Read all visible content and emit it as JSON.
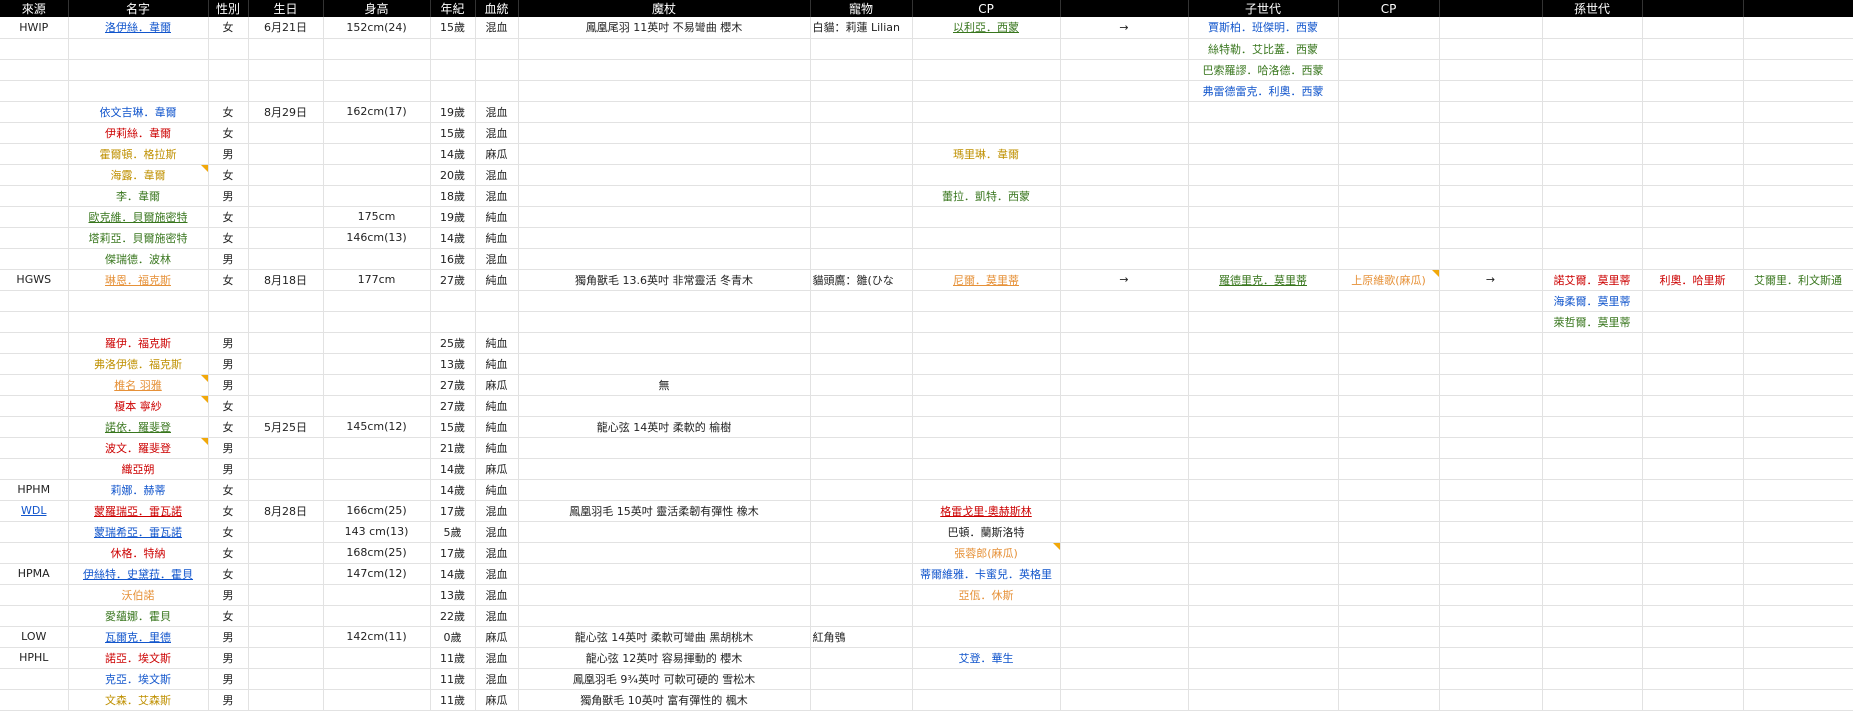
{
  "headers": [
    "來源",
    "名字",
    "性別",
    "生日",
    "身高",
    "年紀",
    "血統",
    "魔杖",
    "寵物",
    "CP",
    "",
    "子世代",
    "CP",
    "",
    "孫世代",
    "",
    ""
  ],
  "colors": {
    "blue": "#1155cc",
    "red": "#cc0000",
    "orange": "#e69138",
    "green": "#38761d",
    "gold": "#bf9000",
    "comment_marker": "#f1a80a"
  },
  "rows": [
    {
      "src": "HWIP",
      "name": "洛伊絲．韋爾",
      "nc": "blue u",
      "sex": "女",
      "bday": "6月21日",
      "height": "152cm(24)",
      "age": "15歲",
      "blood": "混血",
      "wand": "鳳凰尾羽 11英吋 不易彎曲 櫻木",
      "pet": "白貓：莉蓮 Lilian",
      "cp": "以利亞．西蒙",
      "cpc": "green u",
      "arrow": "→",
      "child": "賈斯柏．班傑明．西蒙",
      "chc": "blue"
    },
    {
      "child": "絲特勒．艾比蓋．西蒙",
      "chc": "green"
    },
    {
      "child": "巴索羅謬．哈洛德．西蒙",
      "chc": "green"
    },
    {
      "child": "弗雷德雷克．利奧．西蒙",
      "chc": "blue"
    },
    {
      "name": "依文吉琳．韋爾",
      "nc": "blue",
      "sex": "女",
      "bday": "8月29日",
      "height": "162cm(17)",
      "age": "19歲",
      "blood": "混血"
    },
    {
      "name": "伊莉絲．韋爾",
      "nc": "red",
      "sex": "女",
      "age": "15歲",
      "blood": "混血"
    },
    {
      "name": "霍爾頓．格拉斯",
      "nc": "gold",
      "sex": "男",
      "age": "14歲",
      "blood": "麻瓜",
      "cp": "瑪里琳．韋爾",
      "cpc": "gold"
    },
    {
      "name": "海露．韋爾",
      "nc": "gold",
      "note": true,
      "sex": "女",
      "age": "20歲",
      "blood": "混血"
    },
    {
      "name": "李．韋爾",
      "nc": "green",
      "sex": "男",
      "age": "18歲",
      "blood": "混血",
      "cp": "蕾拉．凱特．西蒙",
      "cpc": "green"
    },
    {
      "name": "歐克維．貝爾施密特",
      "nc": "green u",
      "sex": "女",
      "height": "175cm",
      "age": "19歲",
      "blood": "純血"
    },
    {
      "name": "塔莉亞．貝爾施密特",
      "nc": "green",
      "sex": "女",
      "height": "146cm(13)",
      "age": "14歲",
      "blood": "純血"
    },
    {
      "name": "傑瑞德．波林",
      "nc": "green",
      "sex": "男",
      "age": "16歲",
      "blood": "混血"
    },
    {
      "src": "HGWS",
      "name": "琳恩．福克斯",
      "nc": "orange u",
      "sex": "女",
      "bday": "8月18日",
      "height": "177cm",
      "age": "27歲",
      "blood": "純血",
      "wand": "獨角獸毛 13.6英吋 非常靈活 冬青木",
      "pet": "貓頭鷹：雛(ひな",
      "cp": "尼爾．莫里蒂",
      "cpc": "orange u",
      "arrow": "→",
      "child": "羅德里克．莫里蒂",
      "chc": "green u",
      "cp2": "上原維歌(麻瓜)",
      "cp2c": "orange",
      "cp2note": true,
      "arrow2": "→",
      "grand": "諾艾爾．莫里蒂",
      "gc": "red",
      "g2": "利奧．哈里斯",
      "g2c": "red",
      "g3": "艾爾里．利文斯通",
      "g3c": "green"
    },
    {
      "grand": "海柔爾．莫里蒂",
      "gc": "blue"
    },
    {
      "grand": "萊哲爾．莫里蒂",
      "gc": "green"
    },
    {
      "name": "羅伊．福克斯",
      "nc": "red",
      "sex": "男",
      "age": "25歲",
      "blood": "純血"
    },
    {
      "name": "弗洛伊德．福克斯",
      "nc": "gold",
      "sex": "男",
      "age": "13歲",
      "blood": "純血"
    },
    {
      "name": "椎名 羽雅",
      "nc": "orange u",
      "note": true,
      "sex": "男",
      "age": "27歲",
      "blood": "麻瓜",
      "wand": "無"
    },
    {
      "name": "榎本 寧紗",
      "nc": "red",
      "note": true,
      "sex": "女",
      "age": "27歲",
      "blood": "純血"
    },
    {
      "name": "諾依．羅斐登",
      "nc": "green u",
      "sex": "女",
      "bday": "5月25日",
      "height": "145cm(12)",
      "age": "15歲",
      "blood": "純血",
      "wand": "龍心弦 14英吋 柔軟的 榆樹"
    },
    {
      "name": "波文．羅斐登",
      "nc": "red",
      "note": true,
      "sex": "男",
      "age": "21歲",
      "blood": "純血"
    },
    {
      "name": "織亞朔",
      "nc": "red",
      "sex": "男",
      "age": "14歲",
      "blood": "麻瓜"
    },
    {
      "src": "HPHM",
      "name": "莉娜．赫蒂",
      "nc": "blue",
      "sex": "女",
      "age": "14歲",
      "blood": "純血"
    },
    {
      "src": "WDL",
      "srcc": "blue u",
      "name": "蒙羅瑞亞．雷瓦諾",
      "nc": "red u",
      "sex": "女",
      "bday": "8月28日",
      "height": "166cm(25)",
      "age": "17歲",
      "blood": "混血",
      "wand": "鳳凰羽毛 15英吋 靈活柔韌有彈性 橡木",
      "cp": "格雷戈里·奧赫斯林",
      "cpc": "red u"
    },
    {
      "name": "蒙瑞希亞．雷瓦諾",
      "nc": "blue u",
      "sex": "女",
      "height": "143 cm(13)",
      "age": "5歲",
      "blood": "混血",
      "cp": "巴頓．蘭斯洛特",
      "cpc": "dark"
    },
    {
      "name": "休格．特納",
      "nc": "red",
      "sex": "女",
      "height": "168cm(25)",
      "age": "17歲",
      "blood": "混血",
      "cp": "張蓉郎(麻瓜)",
      "cpc": "orange",
      "cpnote": true
    },
    {
      "src": "HPMA",
      "name": "伊絲特．史黛菈．霍貝",
      "nc": "blue u",
      "sex": "女",
      "height": "147cm(12)",
      "age": "14歲",
      "blood": "混血",
      "cp": "蒂爾維雅．卡蜜兒．英格里",
      "cpc": "blue"
    },
    {
      "name": "沃伯諾",
      "nc": "orange",
      "sex": "男",
      "age": "13歲",
      "blood": "混血",
      "cp": "亞佤．休斯",
      "cpc": "orange"
    },
    {
      "name": "愛蘊娜．霍貝",
      "nc": "green",
      "sex": "女",
      "age": "22歲",
      "blood": "混血"
    },
    {
      "src": "LOW",
      "name": "瓦爾克．里德",
      "nc": "blue u",
      "sex": "男",
      "height": "142cm(11)",
      "age": "0歲",
      "blood": "麻瓜",
      "wand": "龍心弦 14英吋 柔軟可彎曲 黑胡桃木",
      "pet": "紅角鴞"
    },
    {
      "src": "HPHL",
      "name": "諾亞．埃文斯",
      "nc": "red",
      "sex": "男",
      "age": "11歲",
      "blood": "混血",
      "wand": "龍心弦 12英吋 容易揮動的 櫻木",
      "cp": "艾登．華生",
      "cpc": "blue"
    },
    {
      "name": "克亞．埃文斯",
      "nc": "blue",
      "sex": "男",
      "age": "11歲",
      "blood": "混血",
      "wand": "鳳凰羽毛 9¾英吋 可軟可硬的 雪松木"
    },
    {
      "name": "文森．艾森斯",
      "nc": "gold",
      "sex": "男",
      "age": "11歲",
      "blood": "麻瓜",
      "wand": "獨角獸毛 10英吋 富有彈性的 楓木"
    }
  ]
}
